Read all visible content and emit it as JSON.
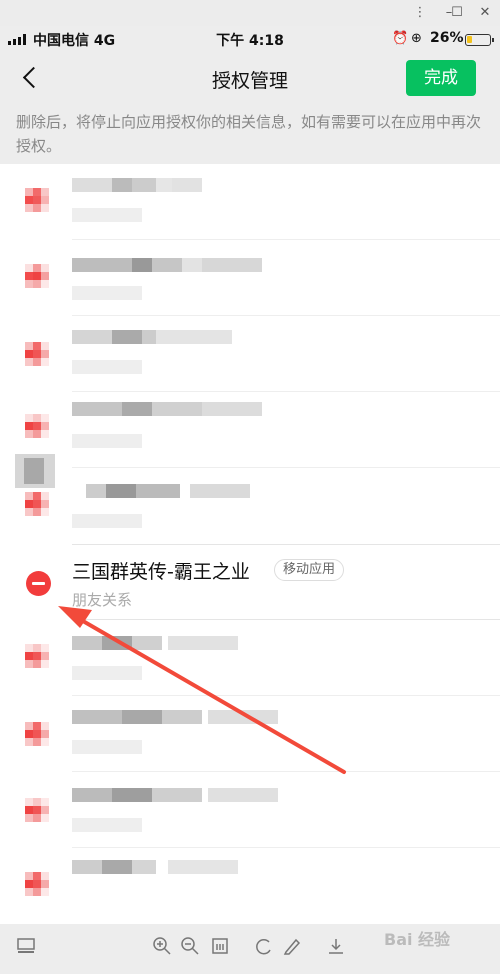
{
  "status": {
    "carrier": "中国电信 4G",
    "time": "下午 4:18",
    "battery": "26%",
    "battery_level": 0.26
  },
  "nav": {
    "title": "授权管理",
    "done_label": "完成"
  },
  "notice": "删除后，将停止向应用授权你的相关信息，如有需要可以在应用中再次授权。",
  "app": {
    "name": "三国群英传-霸王之业",
    "tag": "移动应用",
    "permission": "朋友关系"
  },
  "colors": {
    "accent": "#07c160",
    "remove": "#f23c3c",
    "annotation": "#f24a3a"
  },
  "icons": {
    "back": "chevron-left-icon",
    "remove": "minus-circle-icon",
    "alarm": "alarm-icon",
    "lock": "rotation-lock-icon"
  },
  "watermark": "Bai 经验"
}
